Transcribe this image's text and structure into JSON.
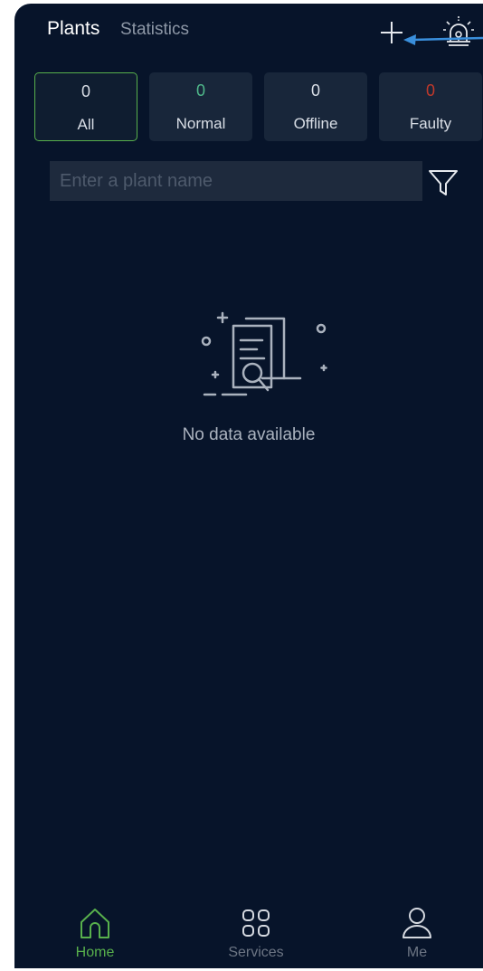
{
  "header": {
    "tabs": [
      {
        "label": "Plants",
        "active": true
      },
      {
        "label": "Statistics",
        "active": false
      }
    ],
    "add_icon": "plus-icon",
    "alarm_icon": "alarm-icon"
  },
  "status_cards": [
    {
      "count": "0",
      "label": "All",
      "count_color": "#d9dee6",
      "selected": true
    },
    {
      "count": "0",
      "label": "Normal",
      "count_color": "#4fb88a",
      "selected": false
    },
    {
      "count": "0",
      "label": "Offline",
      "count_color": "#d9dee6",
      "selected": false
    },
    {
      "count": "0",
      "label": "Faulty",
      "count_color": "#c0392b",
      "selected": false
    }
  ],
  "search": {
    "placeholder": "Enter a plant name",
    "value": "",
    "filter_icon": "filter-icon"
  },
  "empty_state": {
    "icon": "no-data-document-search-icon",
    "message": "No data available"
  },
  "bottom_nav": [
    {
      "label": "Home",
      "icon": "home-icon",
      "active": true
    },
    {
      "label": "Services",
      "icon": "grid-icon",
      "active": false
    },
    {
      "label": "Me",
      "icon": "user-icon",
      "active": false
    }
  ],
  "colors": {
    "background": "#07142a",
    "accent": "#58b04c",
    "annotation_arrow": "#3a8fdc"
  }
}
